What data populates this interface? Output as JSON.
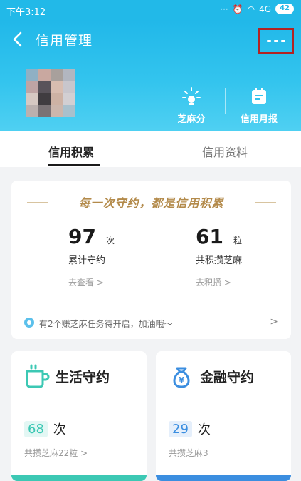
{
  "status_bar": {
    "time": "下午3:12",
    "signal_text": "4G",
    "battery": "42"
  },
  "header": {
    "title": "信用管理",
    "sesame_label": "芝麻分",
    "report_label": "信用月报"
  },
  "tabs": [
    {
      "label": "信用积累"
    },
    {
      "label": "信用资料"
    }
  ],
  "main_card": {
    "slogan": "每一次守约，都是信用积累",
    "stats": [
      {
        "value": "97",
        "unit": "次",
        "label": "累计守约",
        "link": "去查看 >"
      },
      {
        "value": "61",
        "unit": "粒",
        "label": "共积攒芝麻",
        "link": "去积攒 >"
      }
    ],
    "notice": "有2个赚芝麻任务待开启，加油哦～",
    "notice_arrow": ">"
  },
  "cards": [
    {
      "title": "生活守约",
      "count": "68",
      "unit": "次",
      "link": "共攒芝麻22粒 >",
      "accent": "#3cc8b4"
    },
    {
      "title": "金融守约",
      "count": "29",
      "unit": "次",
      "link": "共攒芝麻3",
      "accent": "#3b8ee0"
    }
  ],
  "colors": {
    "header_bg": "#22b9e8",
    "highlight_border": "#b32323",
    "slogan": "#b38a4a"
  },
  "icons": [
    "back-arrow-icon",
    "more-dots-icon",
    "sesame-score-icon",
    "monthly-report-icon",
    "coffee-cup-icon",
    "money-bag-icon",
    "info-dot-icon"
  ]
}
